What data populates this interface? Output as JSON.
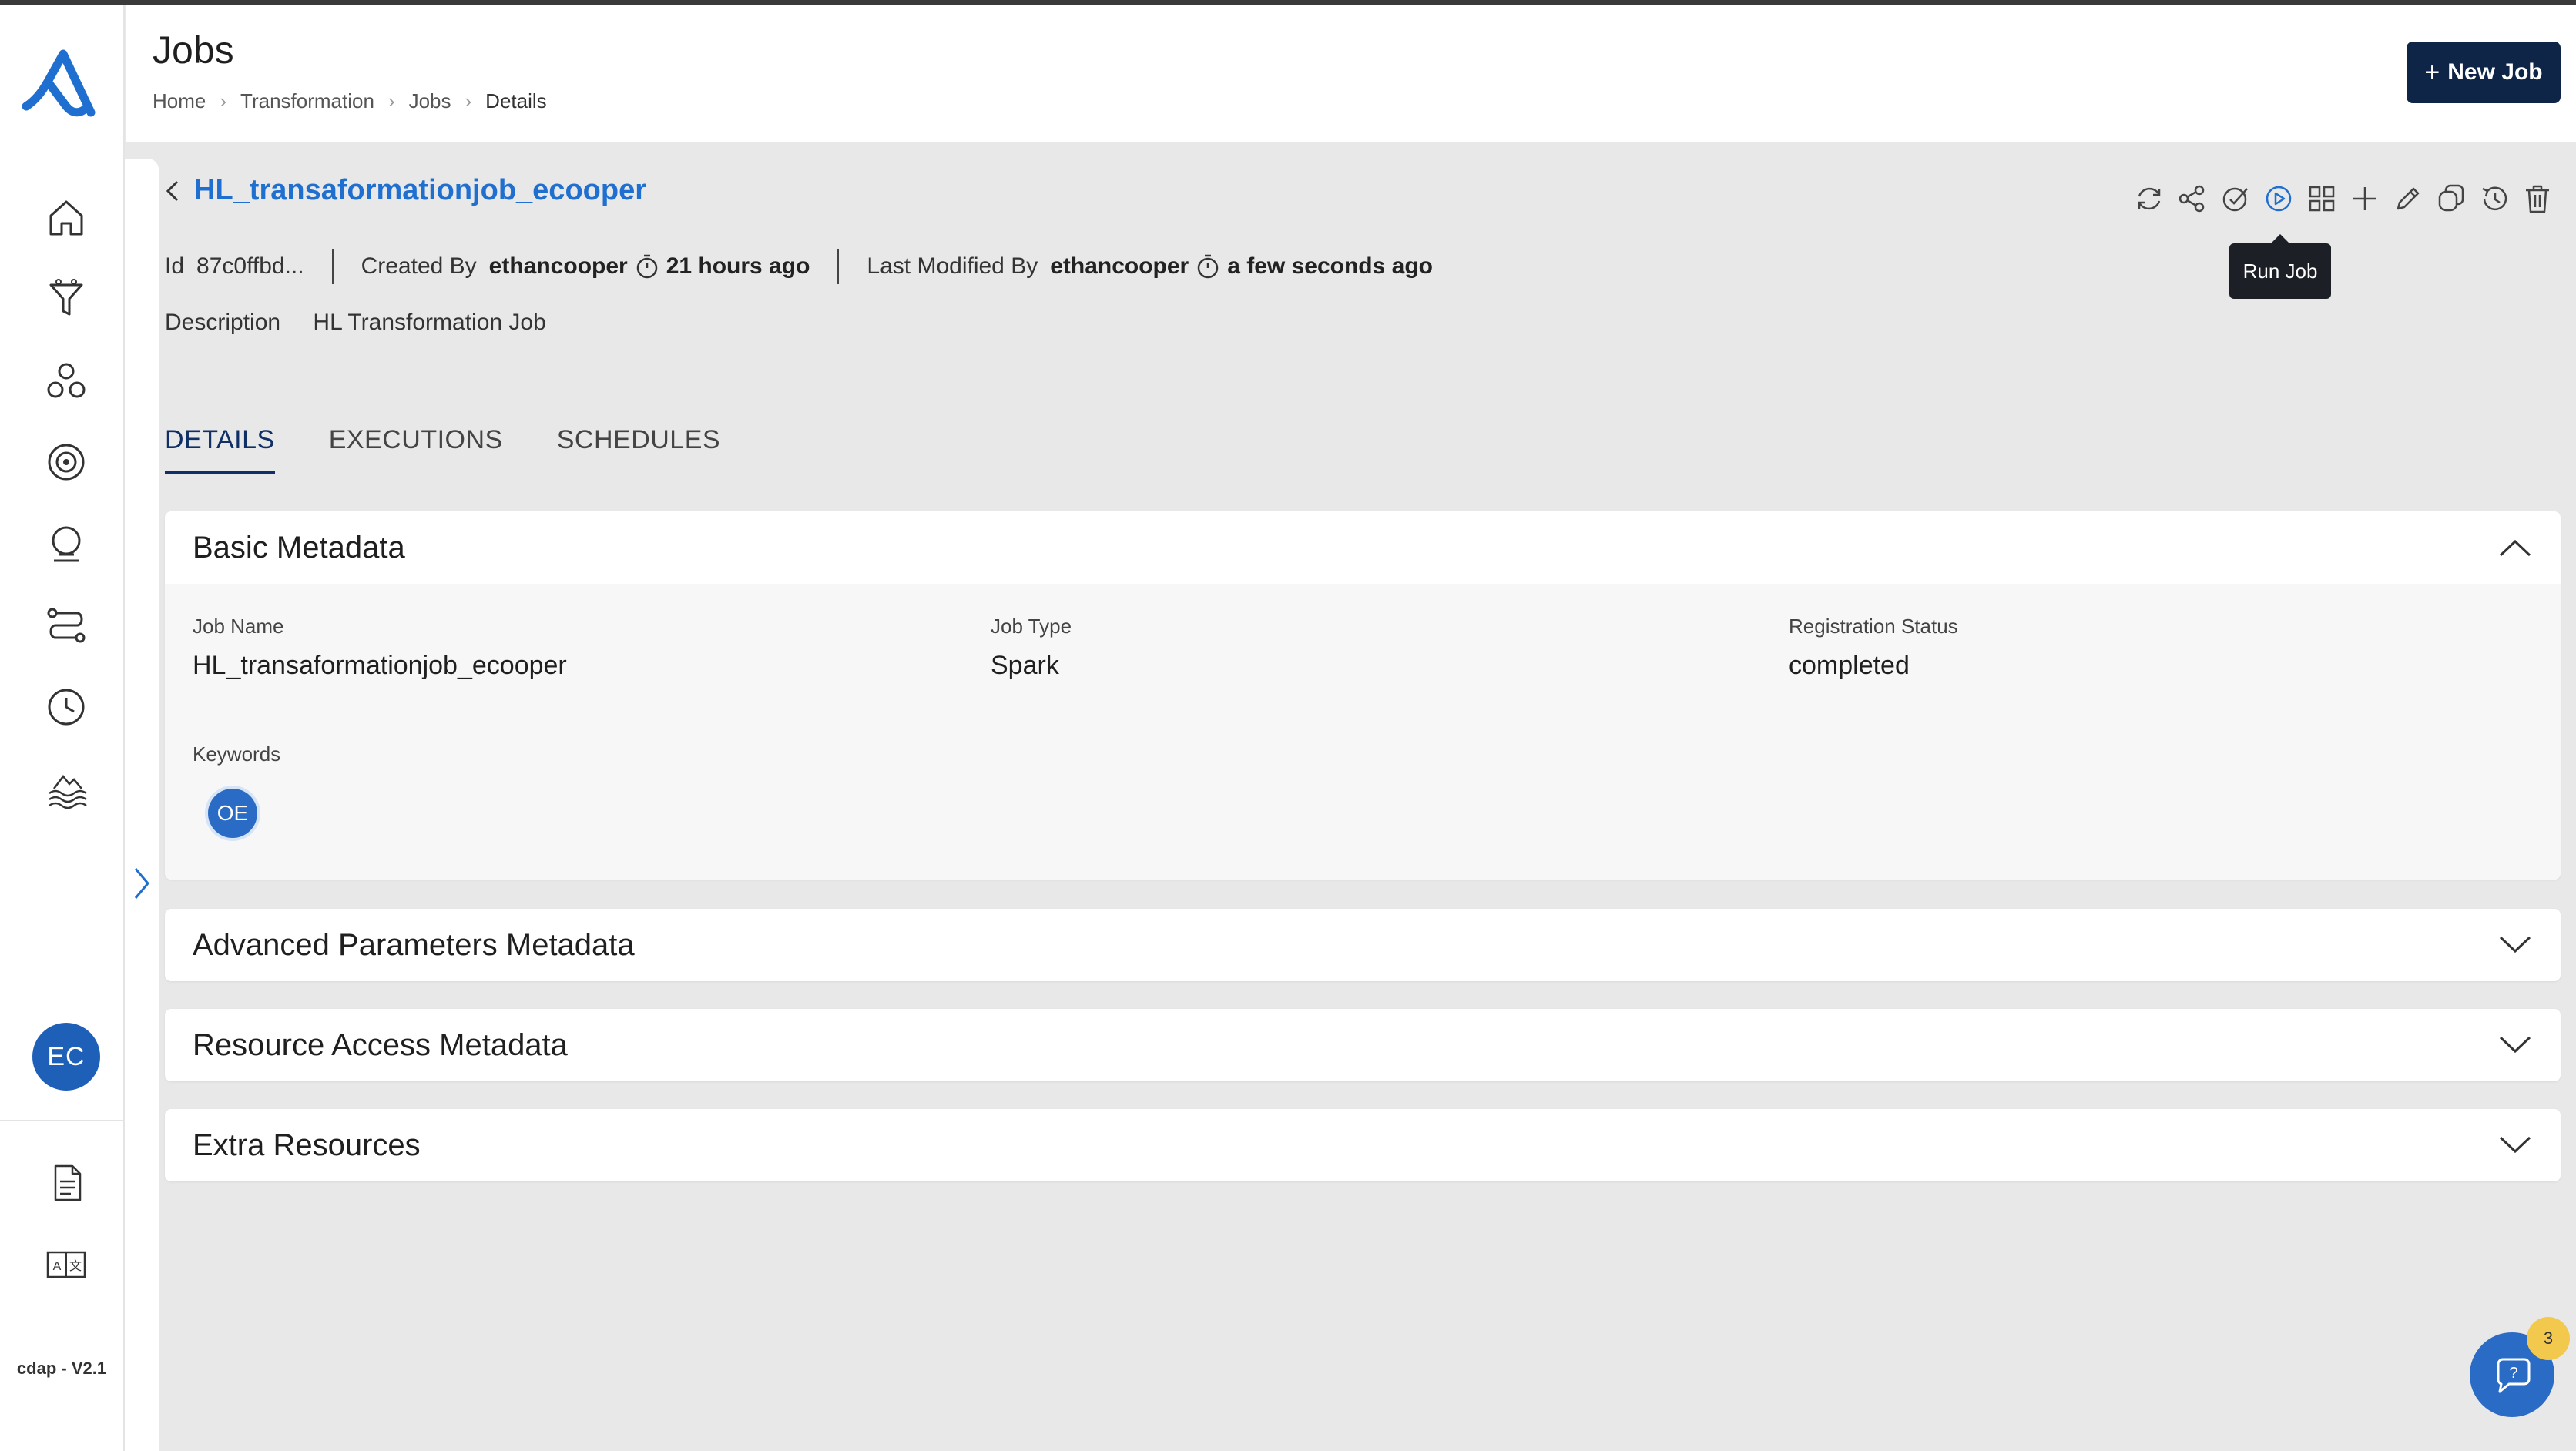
{
  "header": {
    "title": "Jobs",
    "breadcrumb": [
      "Home",
      "Transformation",
      "Jobs",
      "Details"
    ],
    "new_job_label": "New Job"
  },
  "sidebar": {
    "items": [
      {
        "icon": "home-icon"
      },
      {
        "icon": "funnel-icon"
      },
      {
        "icon": "clusters-icon"
      },
      {
        "icon": "settings-target-icon"
      },
      {
        "icon": "crystal-ball-icon"
      },
      {
        "icon": "pipeline-icon"
      },
      {
        "icon": "clock-icon"
      },
      {
        "icon": "data-lake-icon"
      }
    ],
    "avatar_initials": "EC",
    "bottom_items": [
      {
        "icon": "document-icon"
      },
      {
        "icon": "translate-icon"
      }
    ],
    "version": "cdap - V2.1"
  },
  "job": {
    "title": "HL_transaformationjob_ecooper",
    "id_label": "Id",
    "id_value": "87c0ffbd...",
    "created_by_label": "Created By",
    "created_by": "ethancooper",
    "created_ago": "21 hours ago",
    "modified_by_label": "Last Modified By",
    "modified_by": "ethancooper",
    "modified_ago": "a few seconds ago",
    "description_label": "Description",
    "description": "HL Transformation Job"
  },
  "toolbar": {
    "icons": [
      "refresh-icon",
      "share-icon",
      "validate-icon",
      "run-icon",
      "grid-icon",
      "add-icon",
      "edit-icon",
      "copy-icon",
      "history-icon",
      "delete-icon"
    ],
    "tooltip": "Run Job"
  },
  "tabs": [
    "DETAILS",
    "EXECUTIONS",
    "SCHEDULES"
  ],
  "basic_metadata": {
    "title": "Basic Metadata",
    "job_name_label": "Job Name",
    "job_name": "HL_transaformationjob_ecooper",
    "job_type_label": "Job Type",
    "job_type": "Spark",
    "registration_status_label": "Registration Status",
    "registration_status": "completed",
    "keywords_label": "Keywords",
    "keyword_chip": "OE"
  },
  "panels": [
    "Advanced Parameters Metadata",
    "Resource Access Metadata",
    "Extra Resources"
  ],
  "help": {
    "badge_count": "3"
  },
  "colors": {
    "accent": "#1f6fd0",
    "primary_dark": "#0f2547",
    "avatar": "#1e60b8"
  }
}
